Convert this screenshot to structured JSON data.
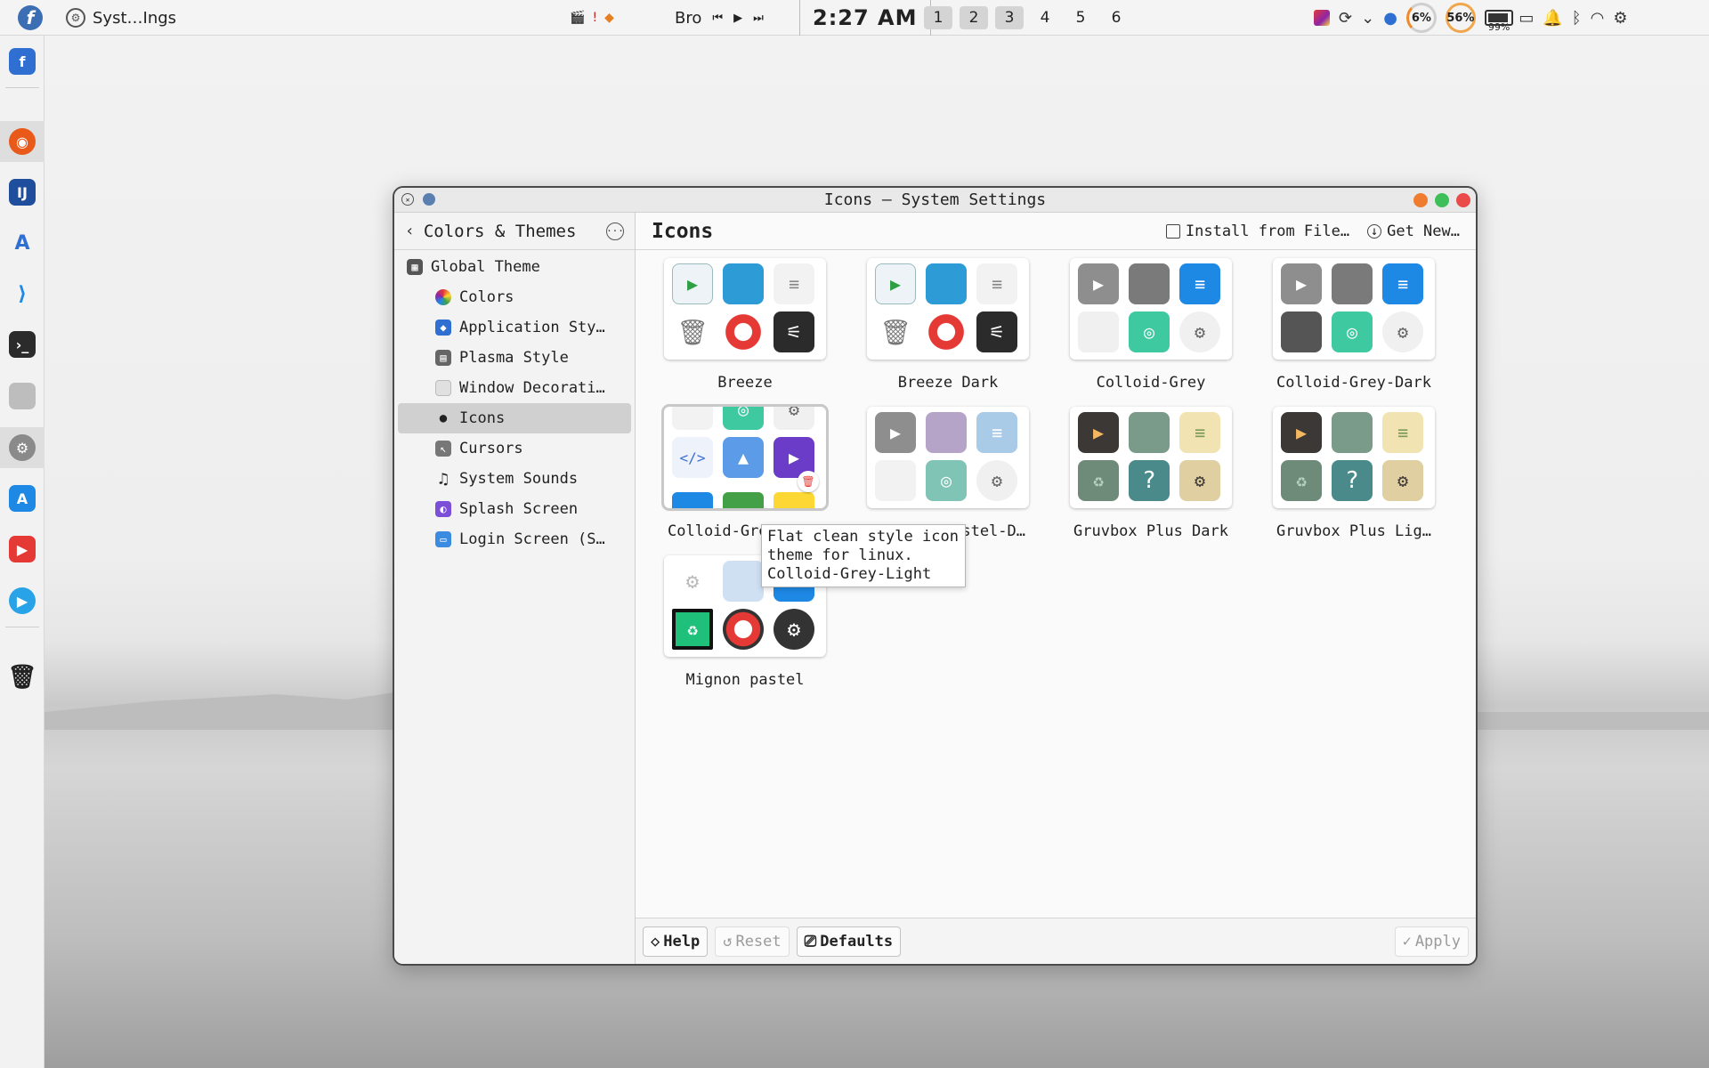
{
  "topbar": {
    "active_window": "Syst…Ings",
    "media_title": "Bro",
    "media_prev": "⏮",
    "media_play": "▶",
    "media_next": "⏭",
    "clock": "2:27 AM",
    "desktops": [
      "1",
      "2",
      "3",
      "4",
      "5",
      "6"
    ],
    "cpu": "6%",
    "memory": "56%",
    "battery": "99%"
  },
  "window": {
    "title": "Icons — System Settings"
  },
  "sidebar": {
    "header": "Colors & Themes",
    "items": [
      {
        "label": "Global Theme",
        "icon": "global-theme-icon",
        "color": "#555555"
      },
      {
        "label": "Colors",
        "icon": "colors-icon",
        "color": "#e9663d"
      },
      {
        "label": "Application Sty…",
        "icon": "application-style-icon",
        "color": "#2f6fd1"
      },
      {
        "label": "Plasma Style",
        "icon": "plasma-style-icon",
        "color": "#555555"
      },
      {
        "label": "Window Decorati…",
        "icon": "window-decorations-icon",
        "color": "#dddddd"
      },
      {
        "label": "Icons",
        "icon": "icons-icon",
        "color": "#333333"
      },
      {
        "label": "Cursors",
        "icon": "cursors-icon",
        "color": "#777777"
      },
      {
        "label": "System Sounds",
        "icon": "music-note-icon",
        "color": "#222222"
      },
      {
        "label": "Splash Screen",
        "icon": "splash-screen-icon",
        "color": "#7b4fd8"
      },
      {
        "label": "Login Screen (S…",
        "icon": "login-screen-icon",
        "color": "#3b8be0"
      }
    ]
  },
  "main": {
    "title": "Icons",
    "install_label": "Install from File…",
    "get_new_label": "Get New…"
  },
  "themes": [
    {
      "label": "Breeze"
    },
    {
      "label": "Breeze Dark"
    },
    {
      "label": "Colloid-Grey"
    },
    {
      "label": "Colloid-Grey-Dark"
    },
    {
      "label": "Colloid-Grey-Lig…"
    },
    {
      "label": "Colloid-Pastel-D…"
    },
    {
      "label": "Gruvbox Plus Dark"
    },
    {
      "label": "Gruvbox Plus Lig…"
    },
    {
      "label": "Mignon pastel"
    }
  ],
  "tooltip": {
    "line1": "Flat clean style icon",
    "line2": "theme for linux.",
    "line3": "Colloid-Grey-Light"
  },
  "footer": {
    "help": "Help",
    "reset": "Reset",
    "defaults": "Defaults",
    "apply": "Apply"
  }
}
